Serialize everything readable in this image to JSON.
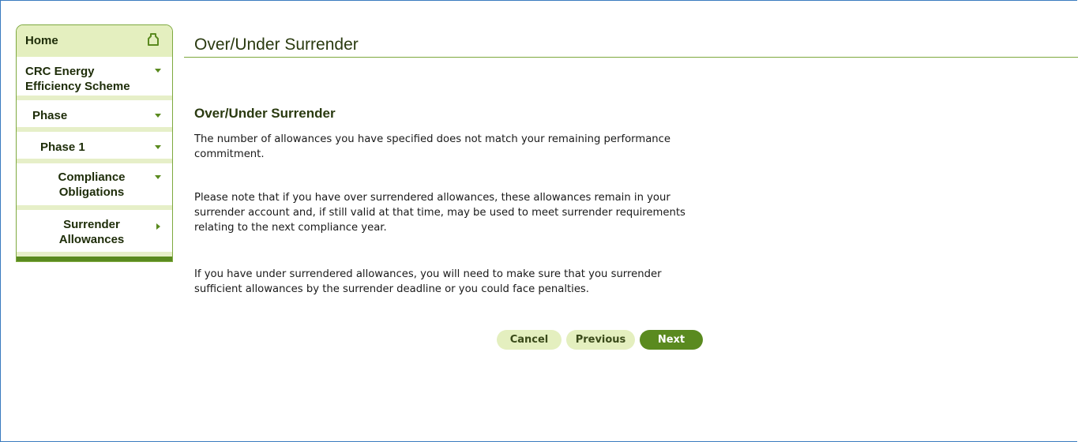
{
  "sidebar": {
    "home_label": "Home",
    "items": [
      {
        "label": "CRC Energy Efficiency Scheme"
      },
      {
        "label": "Phase"
      },
      {
        "label": "Phase 1"
      },
      {
        "label": "Compliance Obligations"
      },
      {
        "label": "Surrender Allowances"
      }
    ]
  },
  "main": {
    "page_title": "Over/Under Surrender",
    "section_title": "Over/Under Surrender",
    "paragraphs": [
      "The number of allowances you have specified does not match your remaining performance commitment.",
      "Please note that if you have over surrendered allowances, these allowances remain in your surrender account and, if still valid at that time, may be used to meet surrender requirements relating to the next compliance year.",
      "If you have under surrendered allowances, you will need to make sure that you surrender sufficient allowances by the surrender deadline or you could face penalties."
    ]
  },
  "buttons": {
    "cancel": "Cancel",
    "previous": "Previous",
    "next": "Next"
  },
  "colors": {
    "accent_dark": "#5a8a1f",
    "accent_light": "#e4efbf",
    "frame_border": "#3a7bbf"
  },
  "icons": {
    "home": "home-icon",
    "expand": "chevron-down-icon",
    "current": "chevron-right-icon"
  }
}
